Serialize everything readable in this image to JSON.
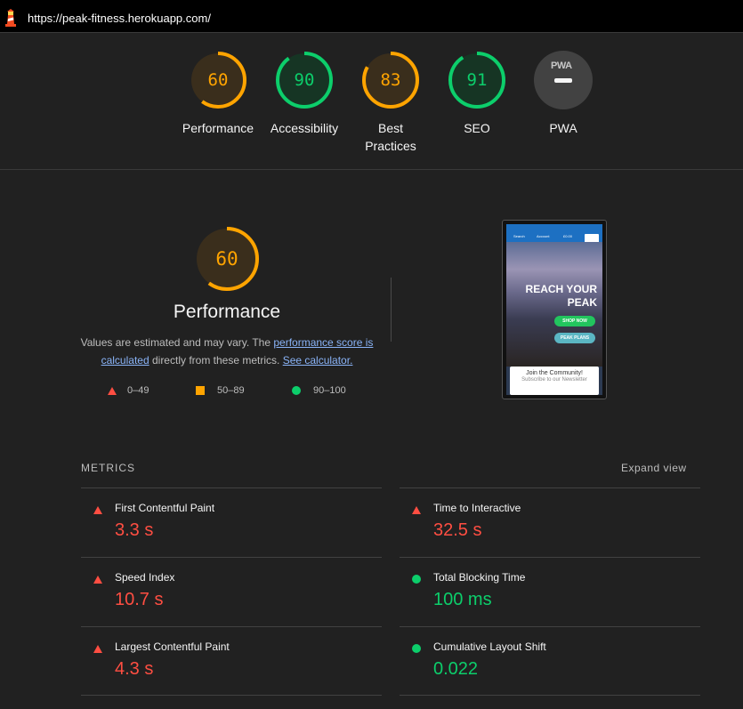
{
  "address_bar": {
    "url": "https://peak-fitness.herokuapp.com/",
    "icon": "lighthouse-icon"
  },
  "categories": [
    {
      "label": "Performance",
      "score": "60",
      "fraction": 0.6,
      "rating": "average"
    },
    {
      "label": "Accessibility",
      "score": "90",
      "fraction": 0.9,
      "rating": "pass"
    },
    {
      "label": "Best Practices",
      "score": "83",
      "fraction": 0.83,
      "rating": "average"
    },
    {
      "label": "SEO",
      "score": "91",
      "fraction": 0.91,
      "rating": "pass"
    },
    {
      "label": "PWA",
      "score": "",
      "badge": "PWA",
      "icon": "pwa-badge-icon"
    }
  ],
  "performance": {
    "score": "60",
    "fraction": 0.6,
    "title": "Performance",
    "desc_prefix": "Values are estimated and may vary. The ",
    "link_score": "performance score is calculated",
    "desc_mid": " directly from these metrics. ",
    "link_calc": "See calculator."
  },
  "legend": [
    {
      "range": "0–49",
      "icon": "triangle-fail-icon"
    },
    {
      "range": "50–89",
      "icon": "square-average-icon"
    },
    {
      "range": "90–100",
      "icon": "circle-pass-icon"
    }
  ],
  "screenshot": {
    "nav": [
      "Search",
      "Account",
      "£0.00"
    ],
    "heading_line1": "REACH YOUR",
    "heading_line2": "PEAK",
    "btn_shop": "SHOP NOW",
    "btn_plans": "PEAK PLANS",
    "card_line1": "Join the  Community!",
    "card_line2": "Subscribe to our Newsletter"
  },
  "metrics_section": {
    "heading": "METRICS",
    "expand": "Expand view"
  },
  "metrics": [
    {
      "name": "First Contentful Paint",
      "value": "3.3 s",
      "rating": "fail"
    },
    {
      "name": "Time to Interactive",
      "value": "32.5 s",
      "rating": "fail"
    },
    {
      "name": "Speed Index",
      "value": "10.7 s",
      "rating": "fail"
    },
    {
      "name": "Total Blocking Time",
      "value": "100 ms",
      "rating": "pass"
    },
    {
      "name": "Largest Contentful Paint",
      "value": "4.3 s",
      "rating": "fail"
    },
    {
      "name": "Cumulative Layout Shift",
      "value": "0.022",
      "rating": "pass"
    }
  ],
  "colors": {
    "fail": "#ff4e42",
    "average": "#ffa400",
    "pass": "#0cce6b",
    "background": "#212121"
  }
}
